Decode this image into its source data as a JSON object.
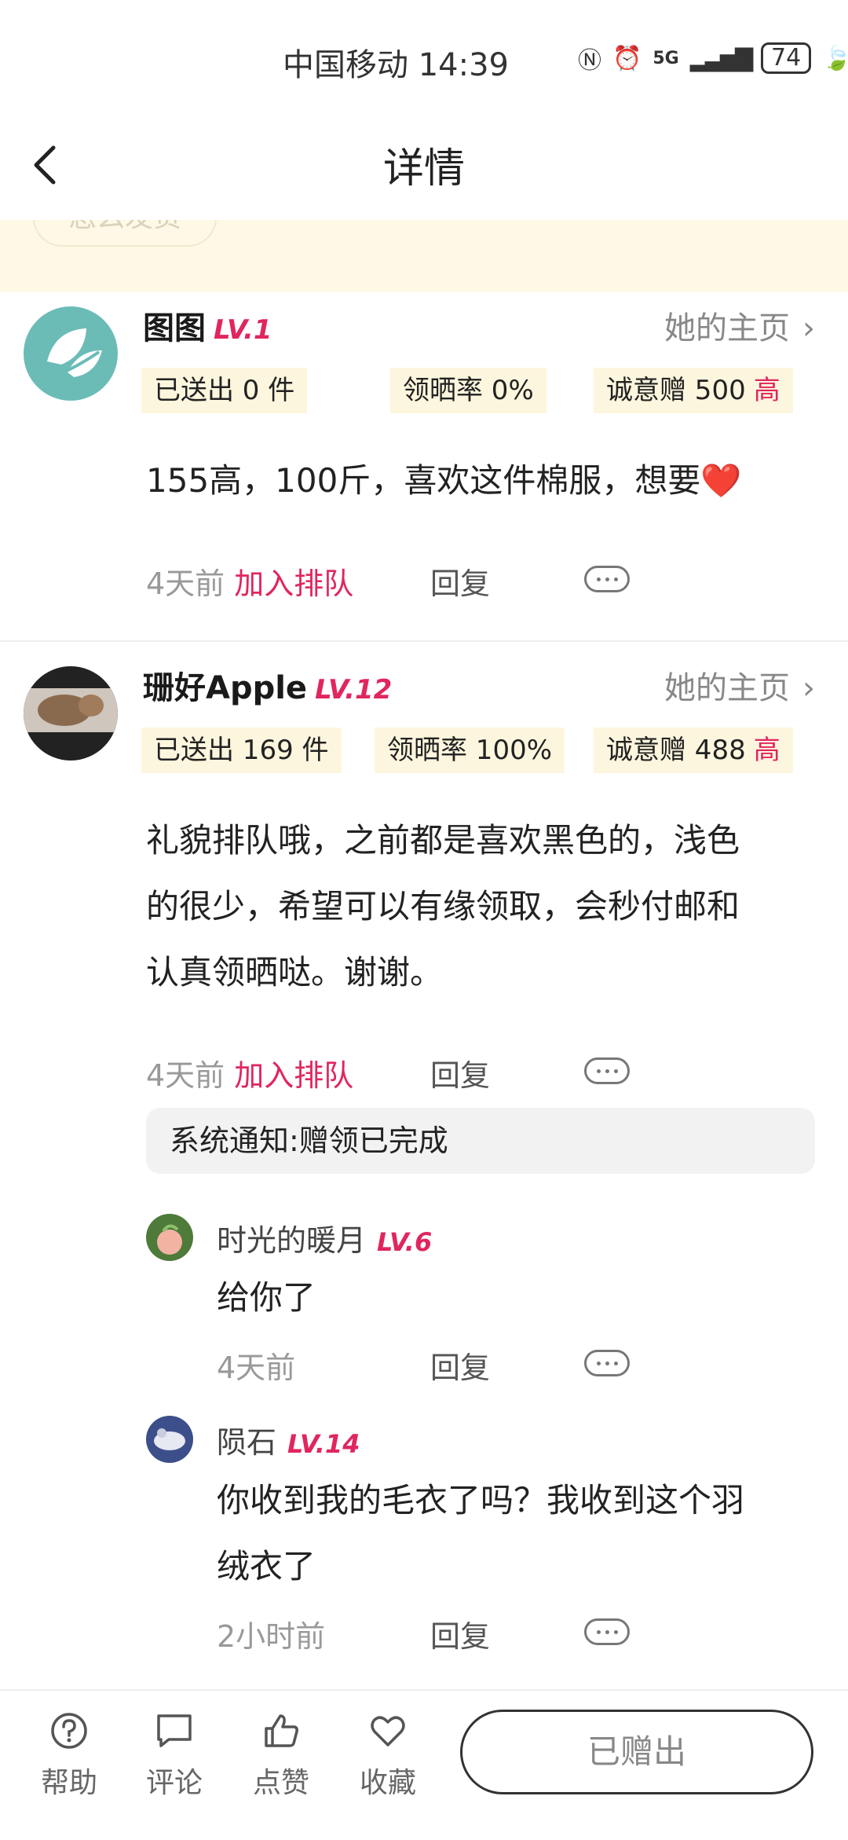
{
  "status_bar": {
    "carrier_time": "中国移动 14:39",
    "network": "5G",
    "battery": "74"
  },
  "header": {
    "title": "详情"
  },
  "notice": {
    "ghost_label": "怎么发货"
  },
  "comments": [
    {
      "name": "图图",
      "level": "LV.1",
      "home_label": "她的主页",
      "stats": {
        "sent": "已送出 0 件",
        "rate": "领晒率 0%",
        "sincerity": "诚意赠 500",
        "sincerity_tag": "高"
      },
      "text": "155高，100斤，喜欢这件棉服，想要❤️",
      "time": "4天前",
      "queue_label": "加入排队",
      "reply_label": "回复"
    },
    {
      "name": "珊好Apple",
      "level": "LV.12",
      "home_label": "她的主页",
      "stats": {
        "sent": "已送出 169 件",
        "rate": "领晒率 100%",
        "sincerity": "诚意赠 488",
        "sincerity_tag": "高"
      },
      "text_lines": [
        "礼貌排队哦，之前都是喜欢黑色的，浅色",
        "的很少，希望可以有缘领取，会秒付邮和",
        "认真领晒哒。谢谢。"
      ],
      "time": "4天前",
      "queue_label": "加入排队",
      "reply_label": "回复",
      "system_notice": "系统通知:赠领已完成",
      "replies": [
        {
          "name": "时光的暖月",
          "level": "LV.6",
          "text": "给你了",
          "time": "4天前",
          "reply_label": "回复"
        },
        {
          "name": "陨石",
          "level": "LV.14",
          "text_lines": [
            "你收到我的毛衣了吗？我收到这个羽",
            "绒衣了"
          ],
          "time": "2小时前",
          "reply_label": "回复"
        }
      ]
    }
  ],
  "bottom_bar": {
    "help": "帮助",
    "comment": "评论",
    "like": "点赞",
    "favorite": "收藏",
    "gift_button": "已赠出"
  },
  "colors": {
    "accent": "#e0265f",
    "stat_bg": "#fdf6de",
    "notice_bg": "#fdf9e6"
  }
}
